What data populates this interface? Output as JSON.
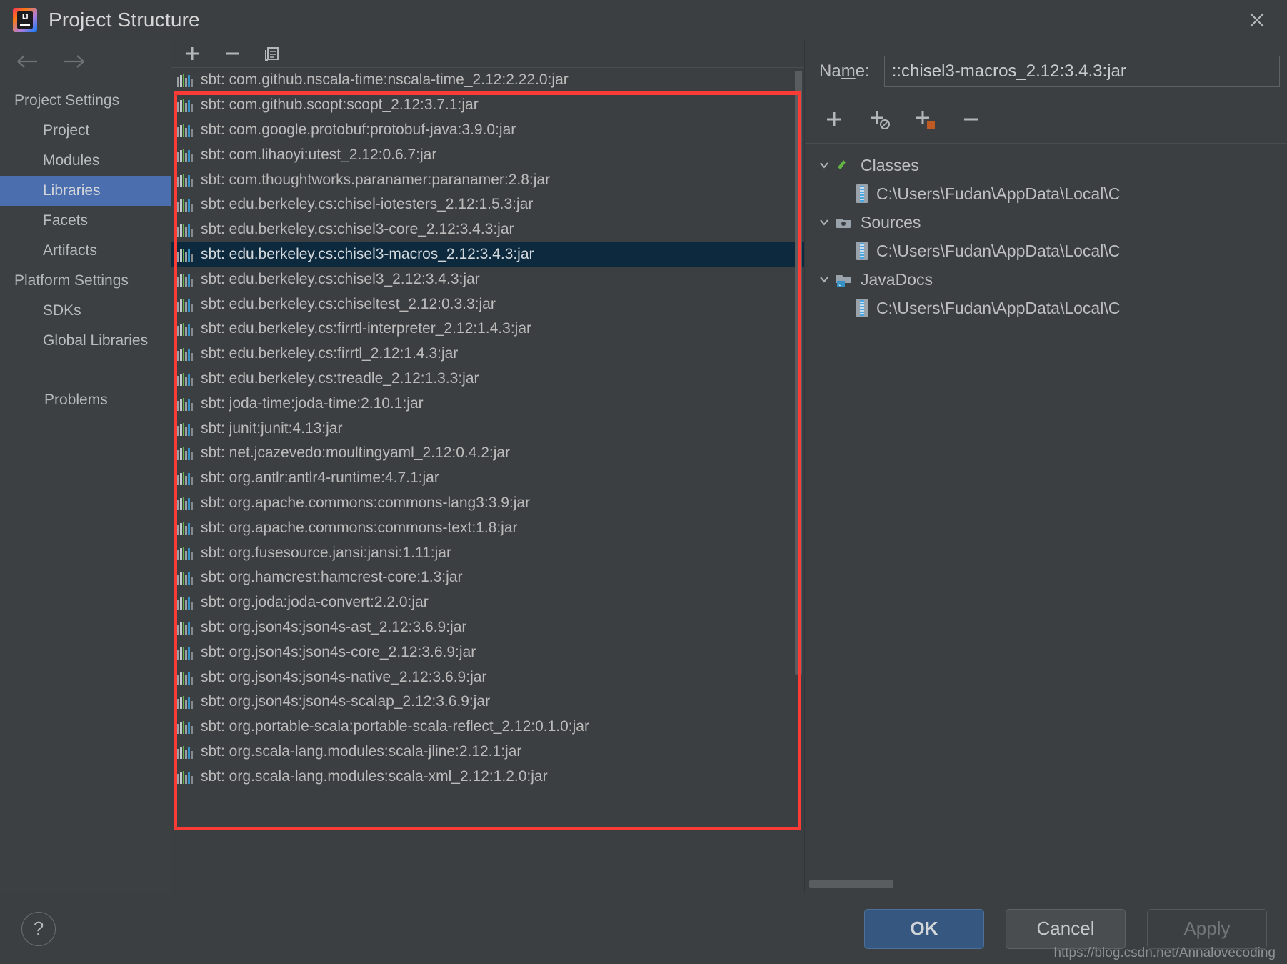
{
  "window": {
    "title": "Project Structure",
    "logo_text": "IJ",
    "close_icon": "close-icon"
  },
  "sidebar": {
    "back_icon": "arrow-left-icon",
    "forward_icon": "arrow-right-icon",
    "groups": [
      {
        "label": "Project Settings",
        "items": [
          {
            "label": "Project",
            "selected": false
          },
          {
            "label": "Modules",
            "selected": false
          },
          {
            "label": "Libraries",
            "selected": true
          },
          {
            "label": "Facets",
            "selected": false
          },
          {
            "label": "Artifacts",
            "selected": false
          }
        ]
      },
      {
        "label": "Platform Settings",
        "items": [
          {
            "label": "SDKs",
            "selected": false
          },
          {
            "label": "Global Libraries",
            "selected": false
          }
        ]
      }
    ],
    "standalone": [
      {
        "label": "Problems"
      }
    ]
  },
  "list_toolbar": {
    "add_label": "add-icon",
    "remove_label": "remove-icon",
    "copy_label": "copy-icon"
  },
  "libraries": {
    "selected_index": 7,
    "items": [
      "sbt: com.github.nscala-time:nscala-time_2.12:2.22.0:jar",
      "sbt: com.github.scopt:scopt_2.12:3.7.1:jar",
      "sbt: com.google.protobuf:protobuf-java:3.9.0:jar",
      "sbt: com.lihaoyi:utest_2.12:0.6.7:jar",
      "sbt: com.thoughtworks.paranamer:paranamer:2.8:jar",
      "sbt: edu.berkeley.cs:chisel-iotesters_2.12:1.5.3:jar",
      "sbt: edu.berkeley.cs:chisel3-core_2.12:3.4.3:jar",
      "sbt: edu.berkeley.cs:chisel3-macros_2.12:3.4.3:jar",
      "sbt: edu.berkeley.cs:chisel3_2.12:3.4.3:jar",
      "sbt: edu.berkeley.cs:chiseltest_2.12:0.3.3:jar",
      "sbt: edu.berkeley.cs:firrtl-interpreter_2.12:1.4.3:jar",
      "sbt: edu.berkeley.cs:firrtl_2.12:1.4.3:jar",
      "sbt: edu.berkeley.cs:treadle_2.12:1.3.3:jar",
      "sbt: joda-time:joda-time:2.10.1:jar",
      "sbt: junit:junit:4.13:jar",
      "sbt: net.jcazevedo:moultingyaml_2.12:0.4.2:jar",
      "sbt: org.antlr:antlr4-runtime:4.7.1:jar",
      "sbt: org.apache.commons:commons-lang3:3.9:jar",
      "sbt: org.apache.commons:commons-text:1.8:jar",
      "sbt: org.fusesource.jansi:jansi:1.11:jar",
      "sbt: org.hamcrest:hamcrest-core:1.3:jar",
      "sbt: org.joda:joda-convert:2.2.0:jar",
      "sbt: org.json4s:json4s-ast_2.12:3.6.9:jar",
      "sbt: org.json4s:json4s-core_2.12:3.6.9:jar",
      "sbt: org.json4s:json4s-native_2.12:3.6.9:jar",
      "sbt: org.json4s:json4s-scalap_2.12:3.6.9:jar",
      "sbt: org.portable-scala:portable-scala-reflect_2.12:0.1.0:jar",
      "sbt: org.scala-lang.modules:scala-jline:2.12.1:jar",
      "sbt: org.scala-lang.modules:scala-xml_2.12:1.2.0:jar"
    ]
  },
  "details": {
    "name_label": "Name:",
    "name_value": "::chisel3-macros_2.12:3.4.3:jar",
    "toolbar": {
      "add_icon": "add-icon",
      "add_url_icon": "add-url-icon",
      "add_folder_icon": "add-folder-icon",
      "remove_icon": "remove-icon"
    },
    "tree": [
      {
        "label": "Classes",
        "icon": "classes-icon",
        "expanded": true,
        "children": [
          "C:\\Users\\Fudan\\AppData\\Local\\C"
        ]
      },
      {
        "label": "Sources",
        "icon": "sources-icon",
        "expanded": true,
        "children": [
          "C:\\Users\\Fudan\\AppData\\Local\\C"
        ]
      },
      {
        "label": "JavaDocs",
        "icon": "javadocs-icon",
        "expanded": true,
        "children": [
          "C:\\Users\\Fudan\\AppData\\Local\\C"
        ]
      }
    ]
  },
  "footer": {
    "help_label": "?",
    "ok_label": "OK",
    "cancel_label": "Cancel",
    "apply_label": "Apply",
    "watermark": "https://blog.csdn.net/Annalovecoding"
  },
  "colors": {
    "selection_blue": "#4b6eaf",
    "list_selection": "#0d293e",
    "annotation_red": "#fb3b36",
    "primary_button": "#365880"
  }
}
